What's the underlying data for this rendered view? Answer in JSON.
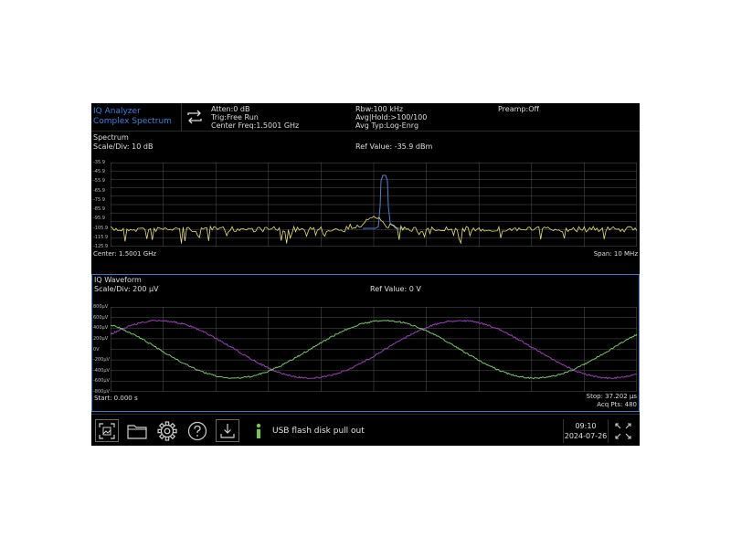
{
  "header": {
    "mode_line1": "IQ Analyzer",
    "mode_line2": "Complex Spectrum",
    "atten": "Atten:0 dB",
    "trig": "Trig:Free Run",
    "center_freq": "Center Freq:1.5001 GHz",
    "rbw": "Rbw:100 kHz",
    "avg_hold": "Avg|Hold:>100/100",
    "avg_type": "Avg Typ:Log-Enrg",
    "preamp": "Preamp:Off"
  },
  "spectrum": {
    "title": "Spectrum",
    "scale": "Scale/Div: 10 dB",
    "ref_value": "Ref Value: -35.9 dBm",
    "center": "Center: 1.5001 GHz",
    "span": "Span: 10 MHz",
    "y_ticks": [
      "-35.9",
      "-45.9",
      "-55.9",
      "-65.9",
      "-75.9",
      "-85.9",
      "-95.9",
      "-105.9",
      "-115.9",
      "-125.9"
    ]
  },
  "iq": {
    "title": "IQ Waveform",
    "scale": "Scale/Div: 200 μV",
    "ref_value": "Ref Value: 0 V",
    "start": "Start: 0.000 s",
    "stop": "Stop: 37.202 μs",
    "acq_pts": "Acq Pts: 480",
    "y_ticks": [
      "800μV",
      "600μV",
      "400μV",
      "200μV",
      "0V",
      "-200μV",
      "-400μV",
      "-600μV",
      "-800μV"
    ]
  },
  "taskbar": {
    "usb_message": "USB flash disk pull out",
    "time": "09:10",
    "date": "2024-07-26"
  },
  "colors": {
    "spectrum_trace": "#e8e36a",
    "spectrum_peak": "#4f7fd8",
    "iq_i_trace": "#9a3fb8",
    "iq_q_trace": "#79c46b",
    "grid": "#555555",
    "info_icon": "#7ac943",
    "accent": "#3d7fe0"
  },
  "icons": {
    "swap": "swap-arrows-icon",
    "screenshot": "screenshot-icon",
    "folder": "folder-icon",
    "settings": "gear-icon",
    "help": "help-icon",
    "download": "download-icon",
    "info": "info-icon",
    "fullscreen": "fullscreen-icon"
  }
}
